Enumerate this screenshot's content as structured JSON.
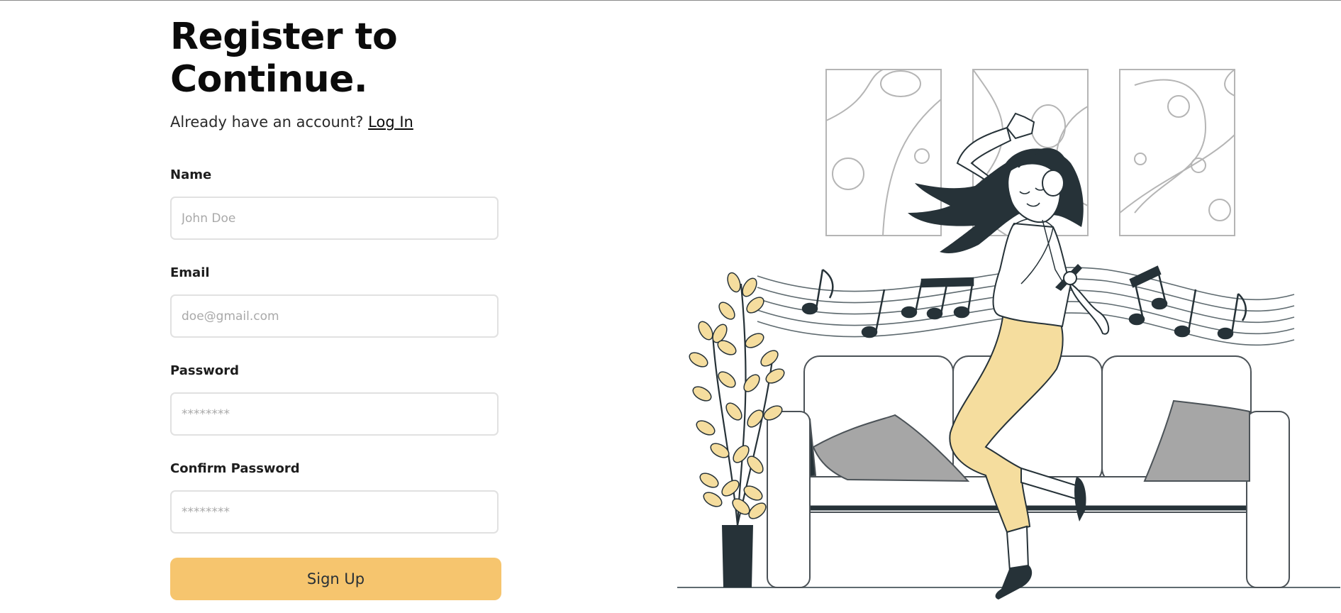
{
  "heading": {
    "title_line1": "Register to",
    "title_line2": "Continue."
  },
  "login_prompt": {
    "text": "Already have an account?",
    "link_label": "Log In"
  },
  "fields": {
    "name": {
      "label": "Name",
      "placeholder": "John Doe",
      "value": ""
    },
    "email": {
      "label": "Email",
      "placeholder": "doe@gmail.com",
      "value": ""
    },
    "password": {
      "label": "Password",
      "placeholder": "********",
      "value": ""
    },
    "confirm_password": {
      "label": "Confirm Password",
      "placeholder": "********",
      "value": ""
    }
  },
  "signup_button": {
    "label": "Sign Up"
  },
  "colors": {
    "accent": "#f6c56e",
    "accent_text": "#283036",
    "illustration_dark": "#263238",
    "illustration_yellow": "#f5dd9e",
    "pillow_gray": "#a6a6a6"
  }
}
